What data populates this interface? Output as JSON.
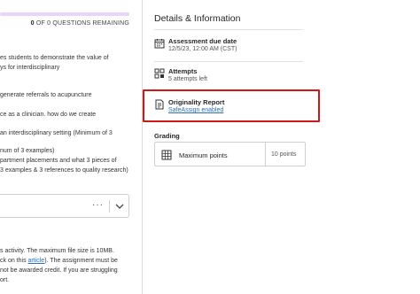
{
  "progress": {
    "count_prefix": "0",
    "count_suffix": "OF 0 QUESTIONS REMAINING"
  },
  "instructions": {
    "lines": [
      "es students to demonstrate the value of",
      "ys for interdisciplinary",
      "generate referrals to acupuncture",
      "ce as a clinician. how do we create",
      "an interdisciplinary setting (Minimum of 3",
      "num of 3 examples)",
      "partment placements and what 3 pieces of",
      "3 examples & 3 references to quality research)"
    ],
    "footer_line1": "s activity. The maximum file size is 10MB.",
    "footer_line2_pre": "ck on this ",
    "footer_link": "article",
    "footer_line2_post": "). The assignment must be",
    "footer_line3": "not be awarded credit. If you are struggling",
    "footer_line4": "ort."
  },
  "question_box": {
    "more_label": "···"
  },
  "details": {
    "heading": "Details & Information",
    "due": {
      "icon": "calendar-icon",
      "title": "Assessment due date",
      "value": "12/5/23, 12:00 AM (CST)"
    },
    "attempts": {
      "icon": "attempts-icon",
      "title": "Attempts",
      "value": "5 attempts left"
    },
    "originality": {
      "icon": "document-check-icon",
      "title": "Originality Report",
      "value": "SafeAssign enabled"
    },
    "highlight_color": "#d01818"
  },
  "grading": {
    "label": "Grading",
    "icon": "grid-icon",
    "title": "Maximum points",
    "points": "10 points"
  }
}
